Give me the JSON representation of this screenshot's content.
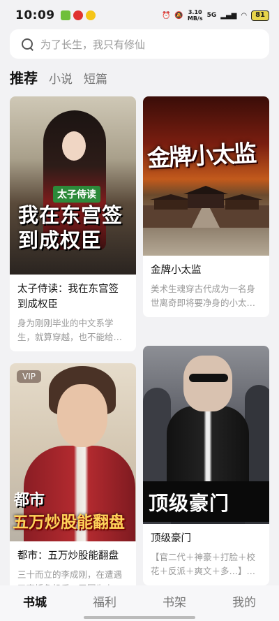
{
  "status_bar": {
    "time": "10:09",
    "speed_top": "3.10",
    "speed_bottom": "MB/s",
    "network": "5G",
    "battery": "81"
  },
  "search": {
    "placeholder": "为了长生，我只有修仙"
  },
  "tabs": [
    {
      "label": "推荐",
      "active": true
    },
    {
      "label": "小说",
      "active": false
    },
    {
      "label": "短篇",
      "active": false
    }
  ],
  "books": [
    {
      "title": "太子侍读：我在东宫签到成权臣",
      "description": "身为刚刚毕业的中文系学生，就算穿越，也不能给…",
      "cover_badge": "太子侍读",
      "cover_text": "我在东宫签到成权臣"
    },
    {
      "title": "金牌小太监",
      "description": "美术生魂穿古代成为一名身世离奇即将要净身的小太…",
      "cover_text": "金牌小太监"
    },
    {
      "title": "都市：五万炒股能翻盘",
      "description": "三十而立的李成刚，在遭遇了离婚危机后，又因为上…",
      "cover_badge": "VIP",
      "cover_tag": "都市",
      "cover_text": "五万炒股能翻盘"
    },
    {
      "title": "顶级豪门",
      "description": "【官二代＋神豪＋打脸＋校花＋反派＋爽文＋多…】…",
      "cover_text": "顶级豪门"
    }
  ],
  "bottom_nav": [
    {
      "label": "书城",
      "active": true
    },
    {
      "label": "福利",
      "active": false
    },
    {
      "label": "书架",
      "active": false
    },
    {
      "label": "我的",
      "active": false
    }
  ]
}
